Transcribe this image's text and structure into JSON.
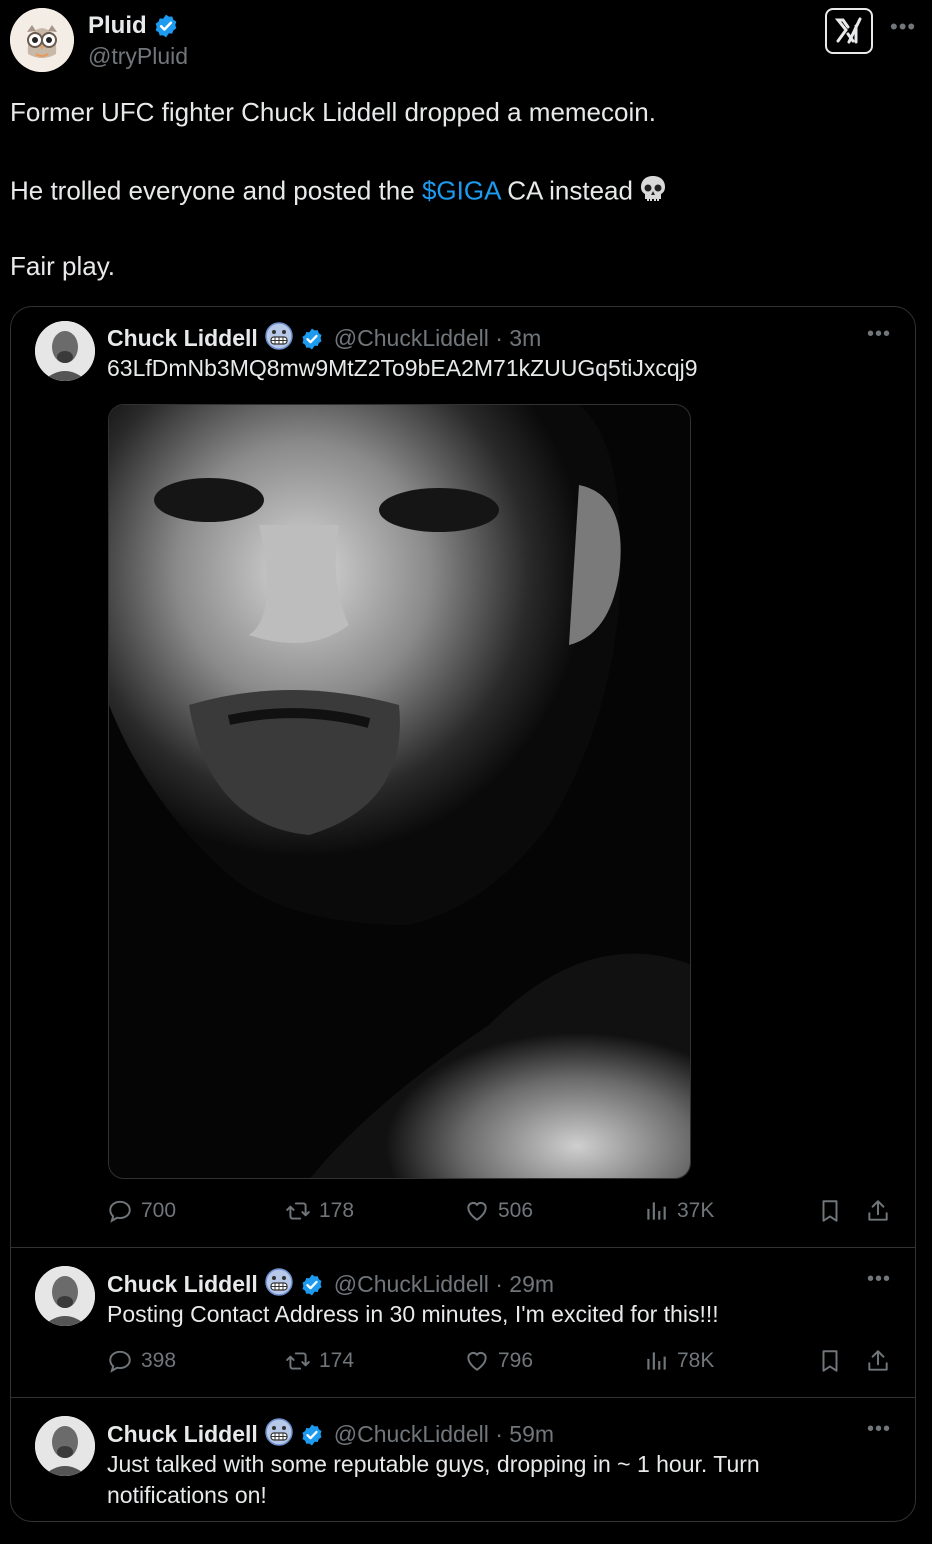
{
  "author": {
    "name": "Pluid",
    "handle": "@tryPluid"
  },
  "tweet": {
    "line1": "Former UFC fighter Chuck Liddell dropped a memecoin.",
    "line2_prefix": "He trolled everyone and posted the ",
    "line2_link": "$GIGA",
    "line2_suffix": " CA instead",
    "line3": "Fair play."
  },
  "quoted": [
    {
      "name": "Chuck Liddell",
      "handle_time": "@ChuckLiddell · 3m",
      "text": [
        "63LfDmNb3MQ8mw9MtZ2To9bEA2M71kZUUGq5tiJxcqj9"
      ],
      "replies": "700",
      "reposts": "178",
      "likes": "506",
      "views": "37K"
    },
    {
      "name": "Chuck Liddell",
      "handle_time": "@ChuckLiddell · 29m",
      "text": [
        "Posting Contact Address in 30 minutes, I'm excited for this!!!"
      ],
      "replies": "398",
      "reposts": "174",
      "likes": "796",
      "views": "78K"
    },
    {
      "name": "Chuck Liddell",
      "handle_time": "@ChuckLiddell · 59m",
      "text": [
        "Just talked with some reputable guys, dropping in ~ 1 hour. Turn",
        "notifications on!"
      ]
    }
  ],
  "icons": {
    "verified": "verified-badge-icon",
    "grok": "grok-icon",
    "more": "more-icon",
    "skull": "skull-emoji-icon",
    "grimace": "grimacing-face-emoji-icon",
    "reply": "reply-icon",
    "repost": "repost-icon",
    "like": "like-icon",
    "views": "views-icon",
    "bookmark": "bookmark-icon",
    "share": "share-icon"
  },
  "colors": {
    "background": "#000000",
    "text": "#e7e9ea",
    "muted": "#71767b",
    "accent": "#1d9bf0",
    "border": "#2f3336"
  }
}
